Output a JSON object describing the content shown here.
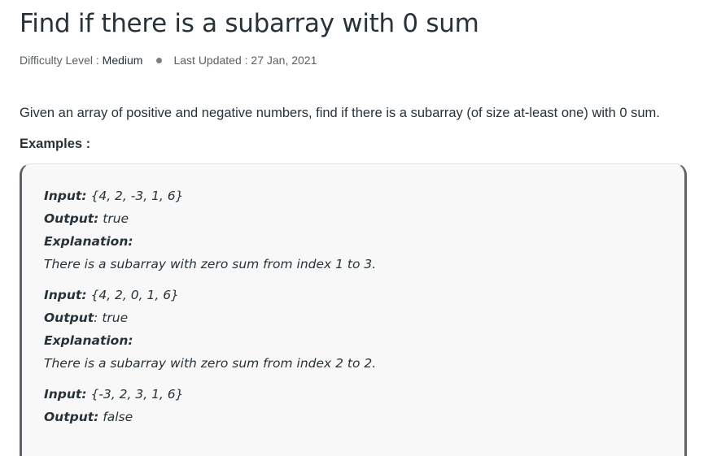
{
  "title": "Find if there is a subarray with 0 sum",
  "meta": {
    "difficulty_label": "Difficulty Level : ",
    "difficulty_value": "Medium",
    "updated_label": "Last Updated : ",
    "updated_value": "27 Jan, 2021"
  },
  "intro": "Given an array of positive and negative numbers, find if there is a subarray (of size at-least one) with 0 sum.",
  "examples_heading": "Examples :",
  "examples": [
    {
      "input_label": "Input:",
      "input_value": " {4, 2, -3, 1, 6}",
      "output_label": "Output:",
      "output_value": " true",
      "explanation_label": "Explanation:",
      "explanation_text": "There is a subarray with zero sum from index 1 to 3."
    },
    {
      "input_label": "Input:",
      "input_value": " {4, 2, 0, 1, 6}",
      "output_label": "Output",
      "output_value": ": true",
      "explanation_label": "Explanation:",
      "explanation_text": "There is a subarray with zero sum from index 2 to 2."
    },
    {
      "input_label": "Input:",
      "input_value": " {-3, 2, 3, 1, 6}",
      "output_label": "Output:",
      "output_value": " false"
    }
  ]
}
